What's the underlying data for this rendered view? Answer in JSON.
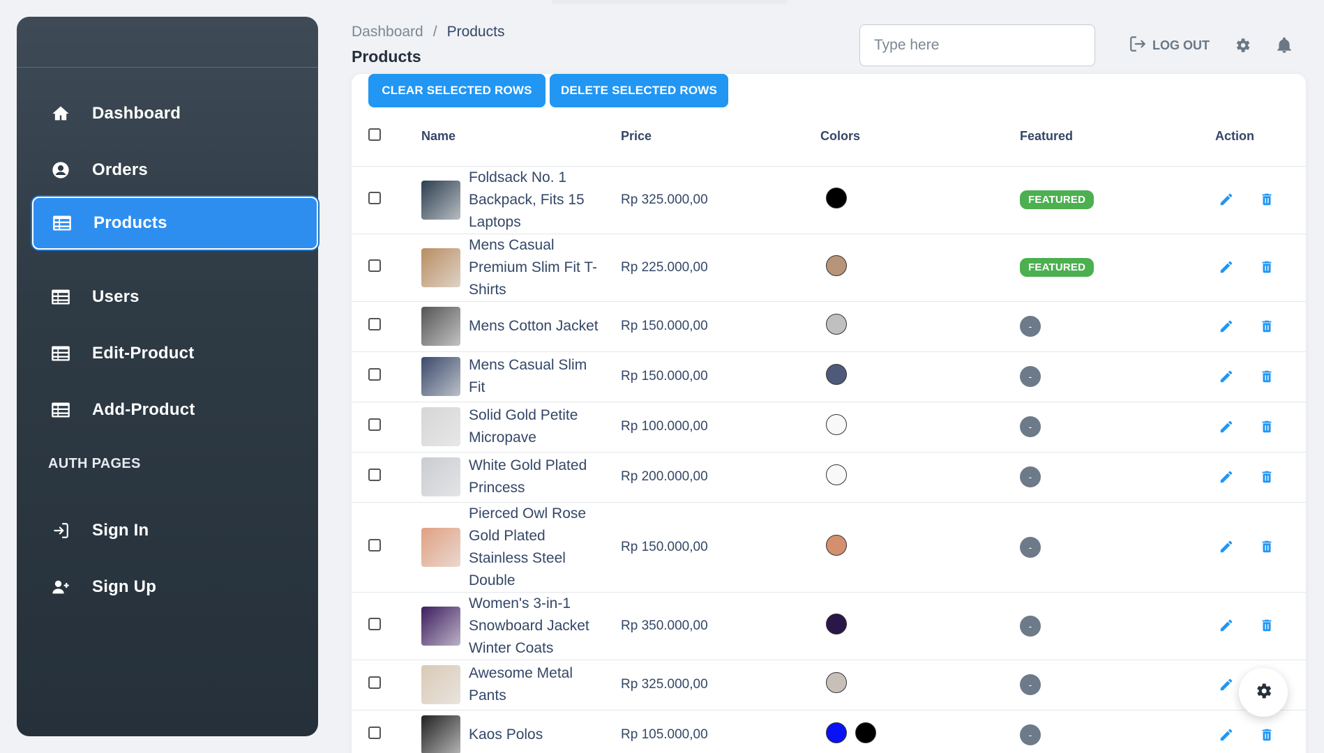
{
  "sidebar": {
    "items": [
      {
        "label": "Dashboard",
        "icon": "home-icon"
      },
      {
        "label": "Orders",
        "icon": "user-circle-icon"
      },
      {
        "label": "Products",
        "icon": "table-icon",
        "active": true
      },
      {
        "label": "Users",
        "icon": "table-icon"
      },
      {
        "label": "Edit-Product",
        "icon": "table-icon"
      },
      {
        "label": "Add-Product",
        "icon": "table-icon"
      }
    ],
    "auth_title": "AUTH PAGES",
    "auth_items": [
      {
        "label": "Sign In",
        "icon": "login-icon"
      },
      {
        "label": "Sign Up",
        "icon": "add-user-icon"
      }
    ]
  },
  "header": {
    "breadcrumb_root": "Dashboard",
    "breadcrumb_sep": "/",
    "breadcrumb_current": "Products",
    "title": "Products",
    "search_placeholder": "Type here",
    "logout_label": "LOG OUT"
  },
  "toolbar": {
    "clear_label": "CLEAR SELECTED ROWS",
    "delete_label": "DELETE SELECTED ROWS"
  },
  "table": {
    "columns": [
      "Name",
      "Price",
      "Colors",
      "Featured",
      "Action"
    ],
    "rows": [
      {
        "name": "Foldsack No. 1 Backpack, Fits 15 Laptops",
        "price": "Rp 325.000,00",
        "colors": [
          "#000000"
        ],
        "featured": "FEATURED",
        "thumb": "#2c3e50"
      },
      {
        "name": "Mens Casual Premium Slim Fit T-Shirts",
        "price": "Rp 225.000,00",
        "colors": [
          "#b89478"
        ],
        "featured": "FEATURED",
        "thumb": "#b88d62"
      },
      {
        "name": "Mens Cotton Jacket",
        "price": "Rp 150.000,00",
        "colors": [
          "#c0c0c0"
        ],
        "featured": "-",
        "thumb": "#555555"
      },
      {
        "name": "Mens Casual Slim Fit",
        "price": "Rp 150.000,00",
        "colors": [
          "#4e5a7a"
        ],
        "featured": "-",
        "thumb": "#3a4a6b"
      },
      {
        "name": "Solid Gold Petite Micropave",
        "price": "Rp 100.000,00",
        "colors": [
          "#f8f8f8"
        ],
        "featured": "-",
        "thumb": "#d6d6d6"
      },
      {
        "name": "White Gold Plated Princess",
        "price": "Rp 200.000,00",
        "colors": [
          "#f8f8f8"
        ],
        "featured": "-",
        "thumb": "#c9ccd1"
      },
      {
        "name": "Pierced Owl Rose Gold Plated Stainless Steel Double",
        "price": "Rp 150.000,00",
        "colors": [
          "#d4906e"
        ],
        "featured": "-",
        "thumb": "#e0a082"
      },
      {
        "name": "Women's 3-in-1 Snowboard Jacket Winter Coats",
        "price": "Rp 350.000,00",
        "colors": [
          "#2a1748"
        ],
        "featured": "-",
        "thumb": "#3d1d5f"
      },
      {
        "name": "Awesome Metal Pants",
        "price": "Rp 325.000,00",
        "colors": [
          "#c8c0b8"
        ],
        "featured": "-",
        "thumb": "#d9c9b5"
      },
      {
        "name": "Kaos Polos",
        "price": "Rp 105.000,00",
        "colors": [
          "#0a12f5",
          "#000000"
        ],
        "featured": "-",
        "thumb": "#222222"
      }
    ]
  },
  "colors": {
    "accent": "#2196f3",
    "featured": "#4caf50",
    "sidebar": "#2e3a44"
  }
}
